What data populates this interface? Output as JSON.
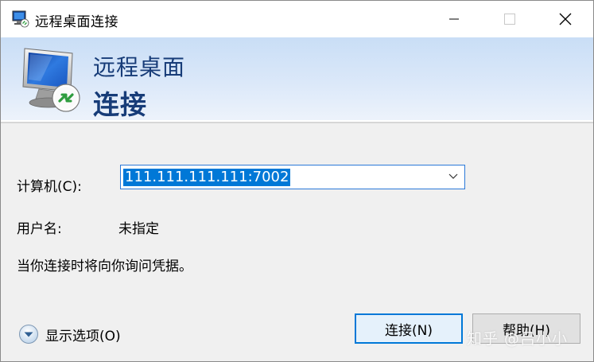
{
  "window": {
    "title": "远程桌面连接",
    "controls": {
      "minimize": "minimize",
      "maximize": "maximize",
      "close": "close"
    }
  },
  "banner": {
    "line1": "远程桌面",
    "line2": "连接"
  },
  "form": {
    "computer_label": "计算机(C):",
    "computer_value": "111.111.111.111:7002",
    "username_label": "用户名:",
    "username_value": "未指定",
    "info": "当你连接时将向你询问凭据。"
  },
  "footer": {
    "show_options": "显示选项(O)",
    "connect": "连接(N)",
    "help": "帮助(H)"
  },
  "watermark": "知乎 @吕小小",
  "colors": {
    "accent": "#0078d7",
    "banner_text": "#173c78",
    "selection": "#0078d7"
  }
}
